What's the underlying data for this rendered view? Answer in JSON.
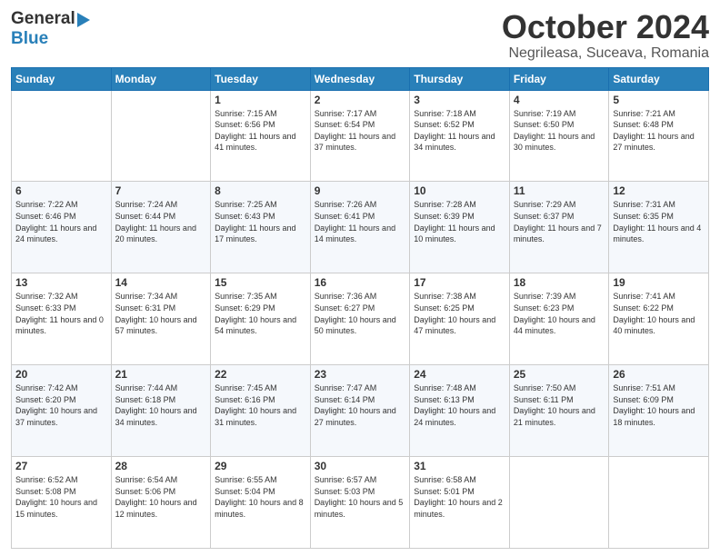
{
  "header": {
    "logo_line1": "General",
    "logo_line2": "Blue",
    "month": "October 2024",
    "location": "Negrileasa, Suceava, Romania"
  },
  "days_of_week": [
    "Sunday",
    "Monday",
    "Tuesday",
    "Wednesday",
    "Thursday",
    "Friday",
    "Saturday"
  ],
  "weeks": [
    [
      {
        "day": "",
        "content": ""
      },
      {
        "day": "",
        "content": ""
      },
      {
        "day": "1",
        "content": "Sunrise: 7:15 AM\nSunset: 6:56 PM\nDaylight: 11 hours and 41 minutes."
      },
      {
        "day": "2",
        "content": "Sunrise: 7:17 AM\nSunset: 6:54 PM\nDaylight: 11 hours and 37 minutes."
      },
      {
        "day": "3",
        "content": "Sunrise: 7:18 AM\nSunset: 6:52 PM\nDaylight: 11 hours and 34 minutes."
      },
      {
        "day": "4",
        "content": "Sunrise: 7:19 AM\nSunset: 6:50 PM\nDaylight: 11 hours and 30 minutes."
      },
      {
        "day": "5",
        "content": "Sunrise: 7:21 AM\nSunset: 6:48 PM\nDaylight: 11 hours and 27 minutes."
      }
    ],
    [
      {
        "day": "6",
        "content": "Sunrise: 7:22 AM\nSunset: 6:46 PM\nDaylight: 11 hours and 24 minutes."
      },
      {
        "day": "7",
        "content": "Sunrise: 7:24 AM\nSunset: 6:44 PM\nDaylight: 11 hours and 20 minutes."
      },
      {
        "day": "8",
        "content": "Sunrise: 7:25 AM\nSunset: 6:43 PM\nDaylight: 11 hours and 17 minutes."
      },
      {
        "day": "9",
        "content": "Sunrise: 7:26 AM\nSunset: 6:41 PM\nDaylight: 11 hours and 14 minutes."
      },
      {
        "day": "10",
        "content": "Sunrise: 7:28 AM\nSunset: 6:39 PM\nDaylight: 11 hours and 10 minutes."
      },
      {
        "day": "11",
        "content": "Sunrise: 7:29 AM\nSunset: 6:37 PM\nDaylight: 11 hours and 7 minutes."
      },
      {
        "day": "12",
        "content": "Sunrise: 7:31 AM\nSunset: 6:35 PM\nDaylight: 11 hours and 4 minutes."
      }
    ],
    [
      {
        "day": "13",
        "content": "Sunrise: 7:32 AM\nSunset: 6:33 PM\nDaylight: 11 hours and 0 minutes."
      },
      {
        "day": "14",
        "content": "Sunrise: 7:34 AM\nSunset: 6:31 PM\nDaylight: 10 hours and 57 minutes."
      },
      {
        "day": "15",
        "content": "Sunrise: 7:35 AM\nSunset: 6:29 PM\nDaylight: 10 hours and 54 minutes."
      },
      {
        "day": "16",
        "content": "Sunrise: 7:36 AM\nSunset: 6:27 PM\nDaylight: 10 hours and 50 minutes."
      },
      {
        "day": "17",
        "content": "Sunrise: 7:38 AM\nSunset: 6:25 PM\nDaylight: 10 hours and 47 minutes."
      },
      {
        "day": "18",
        "content": "Sunrise: 7:39 AM\nSunset: 6:23 PM\nDaylight: 10 hours and 44 minutes."
      },
      {
        "day": "19",
        "content": "Sunrise: 7:41 AM\nSunset: 6:22 PM\nDaylight: 10 hours and 40 minutes."
      }
    ],
    [
      {
        "day": "20",
        "content": "Sunrise: 7:42 AM\nSunset: 6:20 PM\nDaylight: 10 hours and 37 minutes."
      },
      {
        "day": "21",
        "content": "Sunrise: 7:44 AM\nSunset: 6:18 PM\nDaylight: 10 hours and 34 minutes."
      },
      {
        "day": "22",
        "content": "Sunrise: 7:45 AM\nSunset: 6:16 PM\nDaylight: 10 hours and 31 minutes."
      },
      {
        "day": "23",
        "content": "Sunrise: 7:47 AM\nSunset: 6:14 PM\nDaylight: 10 hours and 27 minutes."
      },
      {
        "day": "24",
        "content": "Sunrise: 7:48 AM\nSunset: 6:13 PM\nDaylight: 10 hours and 24 minutes."
      },
      {
        "day": "25",
        "content": "Sunrise: 7:50 AM\nSunset: 6:11 PM\nDaylight: 10 hours and 21 minutes."
      },
      {
        "day": "26",
        "content": "Sunrise: 7:51 AM\nSunset: 6:09 PM\nDaylight: 10 hours and 18 minutes."
      }
    ],
    [
      {
        "day": "27",
        "content": "Sunrise: 6:52 AM\nSunset: 5:08 PM\nDaylight: 10 hours and 15 minutes."
      },
      {
        "day": "28",
        "content": "Sunrise: 6:54 AM\nSunset: 5:06 PM\nDaylight: 10 hours and 12 minutes."
      },
      {
        "day": "29",
        "content": "Sunrise: 6:55 AM\nSunset: 5:04 PM\nDaylight: 10 hours and 8 minutes."
      },
      {
        "day": "30",
        "content": "Sunrise: 6:57 AM\nSunset: 5:03 PM\nDaylight: 10 hours and 5 minutes."
      },
      {
        "day": "31",
        "content": "Sunrise: 6:58 AM\nSunset: 5:01 PM\nDaylight: 10 hours and 2 minutes."
      },
      {
        "day": "",
        "content": ""
      },
      {
        "day": "",
        "content": ""
      }
    ]
  ]
}
